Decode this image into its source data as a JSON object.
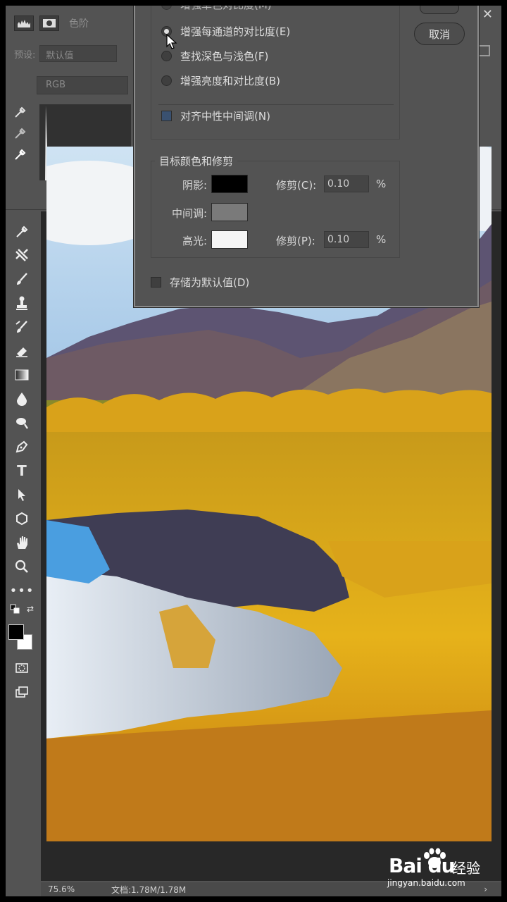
{
  "panel": {
    "title": "色阶",
    "preset_label": "预设:",
    "preset_value": "默认值",
    "channel_value": "RGB"
  },
  "dialog": {
    "options": [
      {
        "label": "增强单色对比度(M)",
        "checked": false
      },
      {
        "label": "增强每通道的对比度(E)",
        "checked": true
      },
      {
        "label": "查找深色与浅色(F)",
        "checked": false
      },
      {
        "label": "增强亮度和对比度(B)",
        "checked": false
      }
    ],
    "snap_neutral_label": "对齐中性中间调(N)",
    "snap_neutral_checked": true,
    "cancel_label": "取消",
    "target_group_label": "目标颜色和修剪",
    "shadows_label": "阴影:",
    "shadows_color": "#000000",
    "midtones_label": "中间调:",
    "midtones_color": "#7a7a7a",
    "highlights_label": "高光:",
    "highlights_color": "#f4f4f4",
    "shadows_clip_label": "修剪(C):",
    "shadows_clip_value": "0.10",
    "highlights_clip_label": "修剪(P):",
    "highlights_clip_value": "0.10",
    "percent": "%",
    "save_default_label": "存储为默认值(D)",
    "save_default_checked": false
  },
  "toolbar": {
    "tools": [
      "eyedropper-tool-icon",
      "crop-tool-icon",
      "brush-tool-icon",
      "clone-stamp-tool-icon",
      "history-brush-tool-icon",
      "eraser-tool-icon",
      "gradient-tool-icon",
      "blur-tool-icon",
      "dodge-tool-icon",
      "pen-tool-icon",
      "type-tool-icon",
      "path-select-tool-icon",
      "shape-tool-icon",
      "hand-tool-icon",
      "zoom-tool-icon",
      "more-tools-icon"
    ],
    "foreground_color": "#000000",
    "background_color": "#ffffff"
  },
  "status": {
    "zoom": "75.6%",
    "doc_info": "文档:1.78M/1.78M",
    "arrow": "›"
  },
  "watermark": {
    "brand": "Bai du",
    "brand_cn": "经验",
    "url": "jingyan.baidu.com"
  }
}
